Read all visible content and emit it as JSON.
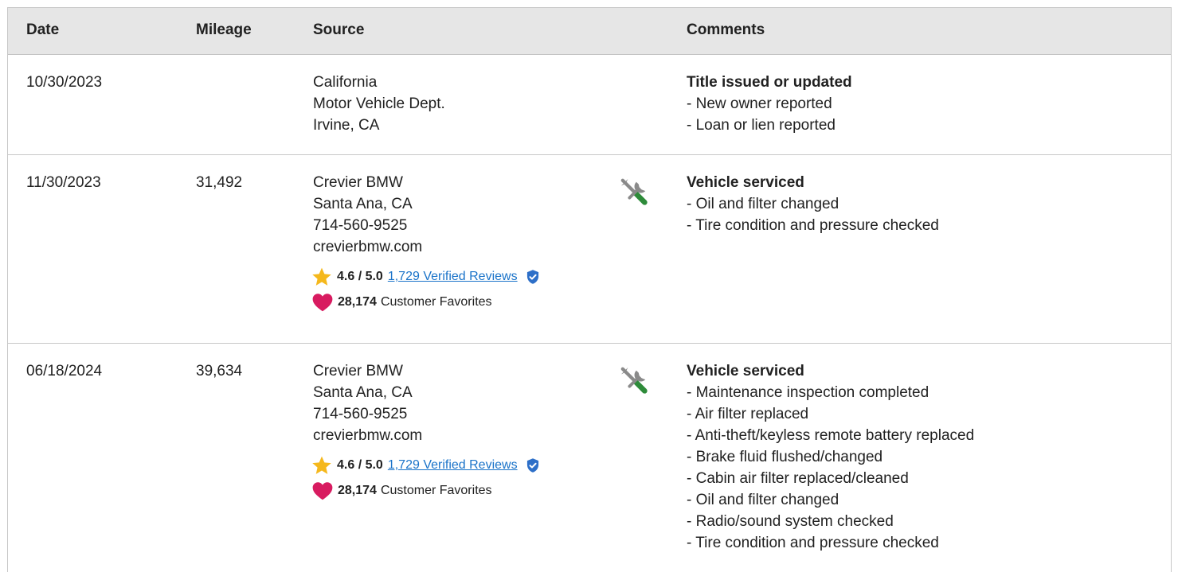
{
  "header": {
    "date": "Date",
    "mileage": "Mileage",
    "source": "Source",
    "comments": "Comments"
  },
  "colors": {
    "header_bg": "#e6e6e6",
    "link": "#1a73c9",
    "star": "#f5b81c",
    "heart": "#d81b60",
    "verified": "#2d6fc8",
    "service_icon_gray": "#888888",
    "service_icon_green": "#2e8b3a"
  },
  "rows": [
    {
      "date": "10/30/2023",
      "mileage": "",
      "source": [
        "California",
        "Motor Vehicle Dept.",
        "Irvine, CA"
      ],
      "icon": "",
      "comment_title": "Title issued or updated",
      "comment_items": [
        "New owner reported",
        "Loan or lien reported"
      ]
    },
    {
      "date": "11/30/2023",
      "mileage": "31,492",
      "source": [
        "Crevier BMW",
        "Santa Ana, CA",
        "714-560-9525",
        "crevierbmw.com"
      ],
      "rating": {
        "score": "4.6 / 5.0",
        "reviews": "1,729 Verified Reviews",
        "favorites_count": "28,174",
        "favorites_label": "Customer Favorites"
      },
      "icon": "service-tools-icon",
      "comment_title": "Vehicle serviced",
      "comment_items": [
        "Oil and filter changed",
        "Tire condition and pressure checked"
      ]
    },
    {
      "date": "06/18/2024",
      "mileage": "39,634",
      "source": [
        "Crevier BMW",
        "Santa Ana, CA",
        "714-560-9525",
        "crevierbmw.com"
      ],
      "rating": {
        "score": "4.6 / 5.0",
        "reviews": "1,729 Verified Reviews",
        "favorites_count": "28,174",
        "favorites_label": "Customer Favorites"
      },
      "icon": "service-tools-icon",
      "comment_title": "Vehicle serviced",
      "comment_items": [
        "Maintenance inspection completed",
        "Air filter replaced",
        "Anti-theft/keyless remote battery replaced",
        "Brake fluid flushed/changed",
        "Cabin air filter replaced/cleaned",
        "Oil and filter changed",
        "Radio/sound system checked",
        "Tire condition and pressure checked"
      ]
    }
  ]
}
